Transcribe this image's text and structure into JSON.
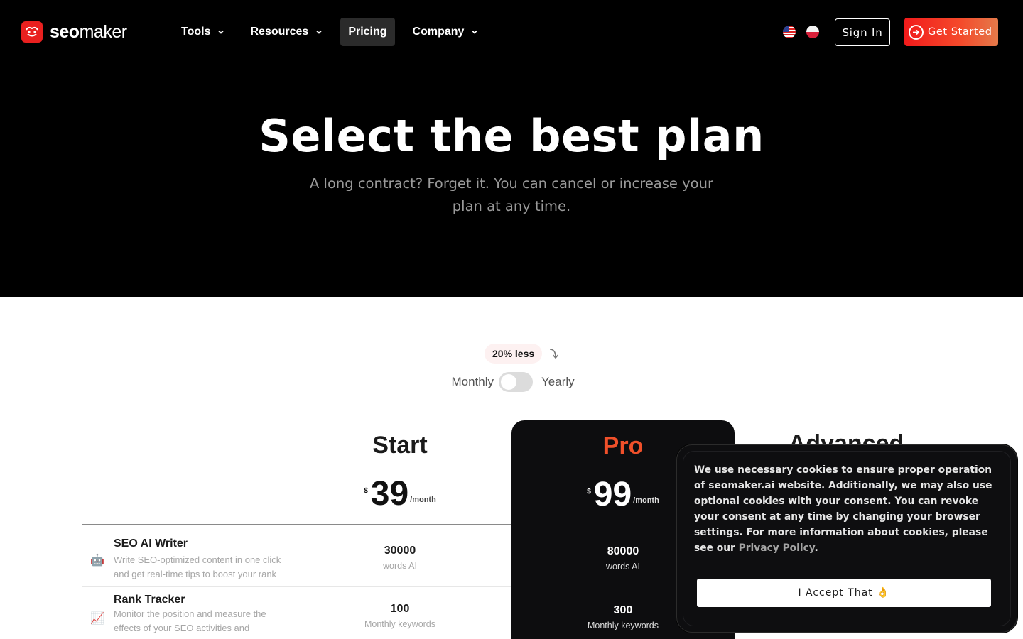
{
  "nav": {
    "logo": {
      "bold": "seo",
      "regular": "maker"
    },
    "items": [
      {
        "label": "Tools",
        "has_dropdown": true
      },
      {
        "label": "Resources",
        "has_dropdown": true
      },
      {
        "label": "Pricing",
        "has_dropdown": false,
        "active": true
      },
      {
        "label": "Company",
        "has_dropdown": true
      }
    ],
    "languages": [
      "us-flag",
      "pl-flag"
    ],
    "sign_in": "Sign In",
    "get_started": "Get Started"
  },
  "hero": {
    "title": "Select the best plan",
    "subtitle": "A long contract? Forget it. You can cancel or increase your plan at any time."
  },
  "billing": {
    "discount_badge": "20% less",
    "monthly_label": "Monthly",
    "yearly_label": "Yearly",
    "yearly_selected": false
  },
  "plans": [
    {
      "name": "Start",
      "currency": "$",
      "price": "39",
      "period": "/month"
    },
    {
      "name": "Pro",
      "currency": "$",
      "price": "99",
      "period": "/month"
    },
    {
      "name": "Advanced"
    }
  ],
  "features": [
    {
      "title": "SEO AI Writer",
      "desc": "Write SEO-optimized content in one click and get real-time tips to boost your rank",
      "icon": "robot-icon",
      "start": {
        "value": "30000",
        "unit": "words AI"
      },
      "pro": {
        "value": "80000",
        "unit": "words AI"
      }
    },
    {
      "title": "Rank Tracker",
      "desc": "Monitor the position and measure the effects of your SEO activities and",
      "icon": "chart-up-icon",
      "start": {
        "value": "100",
        "unit": "Monthly keywords"
      },
      "pro": {
        "value": "300",
        "unit": "Monthly keywords"
      }
    }
  ],
  "cookie": {
    "text": "We use necessary cookies to ensure proper operation of seomaker.ai website. Additionally, we may also use optional cookies with your consent. You can revoke your consent at any time by changing your browser settings. For more information about cookies, please see our ",
    "link": "Privacy Policy",
    "end": ".",
    "button": "I Accept That 👌"
  },
  "colors": {
    "brand_red": "#e9201f",
    "pro_accent": "#f0502a",
    "hero_bg": "#000000"
  }
}
